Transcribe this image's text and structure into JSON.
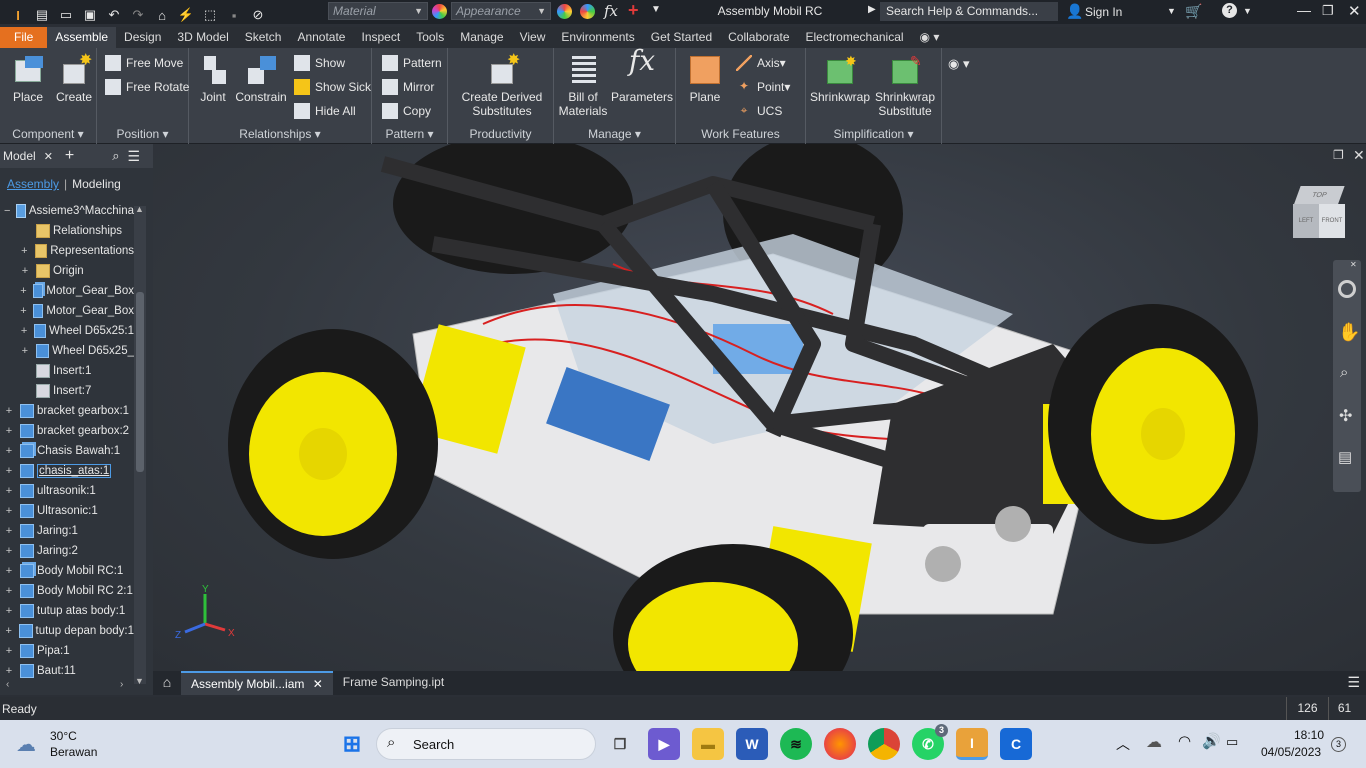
{
  "titlebar": {
    "material_placeholder": "Material",
    "appearance_placeholder": "Appearance",
    "doc_title": "Assembly Mobil RC",
    "search_placeholder": "Search Help & Commands...",
    "sign_in": "Sign In"
  },
  "tabs": [
    "File",
    "Assemble",
    "Design",
    "3D Model",
    "Sketch",
    "Annotate",
    "Inspect",
    "Tools",
    "Manage",
    "View",
    "Environments",
    "Get Started",
    "Collaborate",
    "Electromechanical"
  ],
  "active_tab": "Assemble",
  "ribbon": {
    "component": {
      "label": "Component",
      "place": "Place",
      "create": "Create"
    },
    "position": {
      "label": "Position",
      "free_move": "Free Move",
      "free_rotate": "Free Rotate"
    },
    "relationships": {
      "label": "Relationships",
      "joint": "Joint",
      "constrain": "Constrain",
      "show": "Show",
      "show_sick": "Show Sick",
      "hide_all": "Hide All"
    },
    "pattern": {
      "label": "Pattern",
      "pattern": "Pattern",
      "mirror": "Mirror",
      "copy": "Copy"
    },
    "productivity": {
      "label": "Productivity",
      "create_derived_1": "Create Derived",
      "create_derived_2": "Substitutes"
    },
    "manage": {
      "label": "Manage",
      "bom_1": "Bill of",
      "bom_2": "Materials",
      "parameters": "Parameters"
    },
    "work_features": {
      "label": "Work Features",
      "plane": "Plane",
      "axis": "Axis",
      "point": "Point",
      "ucs": "UCS"
    },
    "simplification": {
      "label": "Simplification",
      "shrinkwrap": "Shrinkwrap",
      "shrinkwrap_sub_1": "Shrinkwrap",
      "shrinkwrap_sub_2": "Substitute"
    }
  },
  "browser": {
    "title": "Model",
    "subtab_assembly": "Assembly",
    "subtab_modeling": "Modeling",
    "items": [
      {
        "label": "Assieme3^Macchina",
        "icon": "asmroot",
        "indent": 0,
        "exp": "−"
      },
      {
        "label": "Relationships",
        "icon": "folder",
        "indent": 1,
        "exp": ""
      },
      {
        "label": "Representations",
        "icon": "folder",
        "indent": 1,
        "exp": "+"
      },
      {
        "label": "Origin",
        "icon": "folder",
        "indent": 1,
        "exp": "+"
      },
      {
        "label": "Motor_Gear_Box",
        "icon": "asm",
        "indent": 1,
        "exp": "+"
      },
      {
        "label": "Motor_Gear_Box",
        "icon": "part",
        "indent": 1,
        "exp": "+"
      },
      {
        "label": "Wheel D65x25:1",
        "icon": "part",
        "indent": 1,
        "exp": "+"
      },
      {
        "label": "Wheel D65x25_",
        "icon": "part",
        "indent": 1,
        "exp": "+"
      },
      {
        "label": "Insert:1",
        "icon": "ins",
        "indent": 1,
        "exp": ""
      },
      {
        "label": "Insert:7",
        "icon": "ins",
        "indent": 1,
        "exp": ""
      },
      {
        "label": "bracket gearbox:1",
        "icon": "part",
        "indent": 0,
        "exp": "+"
      },
      {
        "label": "bracket gearbox:2",
        "icon": "part",
        "indent": 0,
        "exp": "+"
      },
      {
        "label": "Chasis Bawah:1",
        "icon": "asm",
        "indent": 0,
        "exp": "+"
      },
      {
        "label": "chasis_atas:1",
        "icon": "part",
        "indent": 0,
        "exp": "+",
        "selected": true
      },
      {
        "label": "ultrasonik:1",
        "icon": "part",
        "indent": 0,
        "exp": "+"
      },
      {
        "label": "Ultrasonic:1",
        "icon": "part",
        "indent": 0,
        "exp": "+"
      },
      {
        "label": "Jaring:1",
        "icon": "part",
        "indent": 0,
        "exp": "+"
      },
      {
        "label": "Jaring:2",
        "icon": "part",
        "indent": 0,
        "exp": "+"
      },
      {
        "label": "Body Mobil RC:1",
        "icon": "asm",
        "indent": 0,
        "exp": "+"
      },
      {
        "label": "Body Mobil RC 2:1",
        "icon": "part",
        "indent": 0,
        "exp": "+"
      },
      {
        "label": "tutup atas body:1",
        "icon": "part",
        "indent": 0,
        "exp": "+"
      },
      {
        "label": "tutup depan body:1",
        "icon": "part",
        "indent": 0,
        "exp": "+"
      },
      {
        "label": "Pipa:1",
        "icon": "part",
        "indent": 0,
        "exp": "+"
      },
      {
        "label": "Baut:11",
        "icon": "part",
        "indent": 0,
        "exp": "+"
      }
    ]
  },
  "viewcube": {
    "top": "TOP",
    "left": "LEFT",
    "front": "FRONT"
  },
  "triad": {
    "x": "X",
    "y": "Y",
    "z": "Z"
  },
  "doc_tabs": [
    {
      "label": "Assembly Mobil...iam",
      "active": true
    },
    {
      "label": "Frame Samping.ipt",
      "active": false
    }
  ],
  "status": {
    "text": "Ready",
    "num1": "126",
    "num2": "61"
  },
  "taskbar": {
    "weather_temp": "30°C",
    "weather_desc": "Berawan",
    "search_label": "Search",
    "whatsapp_badge": "3",
    "time": "18:10",
    "date": "04/05/2023",
    "notif_count": "3"
  }
}
